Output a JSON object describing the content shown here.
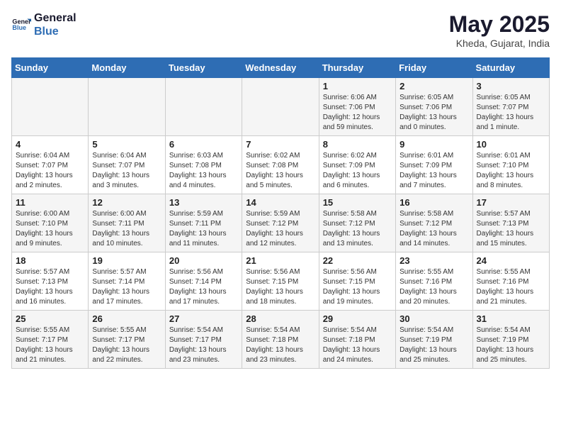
{
  "header": {
    "logo_line1": "General",
    "logo_line2": "Blue",
    "month": "May 2025",
    "location": "Kheda, Gujarat, India"
  },
  "weekdays": [
    "Sunday",
    "Monday",
    "Tuesday",
    "Wednesday",
    "Thursday",
    "Friday",
    "Saturday"
  ],
  "weeks": [
    [
      {
        "day": "",
        "info": ""
      },
      {
        "day": "",
        "info": ""
      },
      {
        "day": "",
        "info": ""
      },
      {
        "day": "",
        "info": ""
      },
      {
        "day": "1",
        "info": "Sunrise: 6:06 AM\nSunset: 7:06 PM\nDaylight: 12 hours\nand 59 minutes."
      },
      {
        "day": "2",
        "info": "Sunrise: 6:05 AM\nSunset: 7:06 PM\nDaylight: 13 hours\nand 0 minutes."
      },
      {
        "day": "3",
        "info": "Sunrise: 6:05 AM\nSunset: 7:07 PM\nDaylight: 13 hours\nand 1 minute."
      }
    ],
    [
      {
        "day": "4",
        "info": "Sunrise: 6:04 AM\nSunset: 7:07 PM\nDaylight: 13 hours\nand 2 minutes."
      },
      {
        "day": "5",
        "info": "Sunrise: 6:04 AM\nSunset: 7:07 PM\nDaylight: 13 hours\nand 3 minutes."
      },
      {
        "day": "6",
        "info": "Sunrise: 6:03 AM\nSunset: 7:08 PM\nDaylight: 13 hours\nand 4 minutes."
      },
      {
        "day": "7",
        "info": "Sunrise: 6:02 AM\nSunset: 7:08 PM\nDaylight: 13 hours\nand 5 minutes."
      },
      {
        "day": "8",
        "info": "Sunrise: 6:02 AM\nSunset: 7:09 PM\nDaylight: 13 hours\nand 6 minutes."
      },
      {
        "day": "9",
        "info": "Sunrise: 6:01 AM\nSunset: 7:09 PM\nDaylight: 13 hours\nand 7 minutes."
      },
      {
        "day": "10",
        "info": "Sunrise: 6:01 AM\nSunset: 7:10 PM\nDaylight: 13 hours\nand 8 minutes."
      }
    ],
    [
      {
        "day": "11",
        "info": "Sunrise: 6:00 AM\nSunset: 7:10 PM\nDaylight: 13 hours\nand 9 minutes."
      },
      {
        "day": "12",
        "info": "Sunrise: 6:00 AM\nSunset: 7:11 PM\nDaylight: 13 hours\nand 10 minutes."
      },
      {
        "day": "13",
        "info": "Sunrise: 5:59 AM\nSunset: 7:11 PM\nDaylight: 13 hours\nand 11 minutes."
      },
      {
        "day": "14",
        "info": "Sunrise: 5:59 AM\nSunset: 7:12 PM\nDaylight: 13 hours\nand 12 minutes."
      },
      {
        "day": "15",
        "info": "Sunrise: 5:58 AM\nSunset: 7:12 PM\nDaylight: 13 hours\nand 13 minutes."
      },
      {
        "day": "16",
        "info": "Sunrise: 5:58 AM\nSunset: 7:12 PM\nDaylight: 13 hours\nand 14 minutes."
      },
      {
        "day": "17",
        "info": "Sunrise: 5:57 AM\nSunset: 7:13 PM\nDaylight: 13 hours\nand 15 minutes."
      }
    ],
    [
      {
        "day": "18",
        "info": "Sunrise: 5:57 AM\nSunset: 7:13 PM\nDaylight: 13 hours\nand 16 minutes."
      },
      {
        "day": "19",
        "info": "Sunrise: 5:57 AM\nSunset: 7:14 PM\nDaylight: 13 hours\nand 17 minutes."
      },
      {
        "day": "20",
        "info": "Sunrise: 5:56 AM\nSunset: 7:14 PM\nDaylight: 13 hours\nand 17 minutes."
      },
      {
        "day": "21",
        "info": "Sunrise: 5:56 AM\nSunset: 7:15 PM\nDaylight: 13 hours\nand 18 minutes."
      },
      {
        "day": "22",
        "info": "Sunrise: 5:56 AM\nSunset: 7:15 PM\nDaylight: 13 hours\nand 19 minutes."
      },
      {
        "day": "23",
        "info": "Sunrise: 5:55 AM\nSunset: 7:16 PM\nDaylight: 13 hours\nand 20 minutes."
      },
      {
        "day": "24",
        "info": "Sunrise: 5:55 AM\nSunset: 7:16 PM\nDaylight: 13 hours\nand 21 minutes."
      }
    ],
    [
      {
        "day": "25",
        "info": "Sunrise: 5:55 AM\nSunset: 7:17 PM\nDaylight: 13 hours\nand 21 minutes."
      },
      {
        "day": "26",
        "info": "Sunrise: 5:55 AM\nSunset: 7:17 PM\nDaylight: 13 hours\nand 22 minutes."
      },
      {
        "day": "27",
        "info": "Sunrise: 5:54 AM\nSunset: 7:17 PM\nDaylight: 13 hours\nand 23 minutes."
      },
      {
        "day": "28",
        "info": "Sunrise: 5:54 AM\nSunset: 7:18 PM\nDaylight: 13 hours\nand 23 minutes."
      },
      {
        "day": "29",
        "info": "Sunrise: 5:54 AM\nSunset: 7:18 PM\nDaylight: 13 hours\nand 24 minutes."
      },
      {
        "day": "30",
        "info": "Sunrise: 5:54 AM\nSunset: 7:19 PM\nDaylight: 13 hours\nand 25 minutes."
      },
      {
        "day": "31",
        "info": "Sunrise: 5:54 AM\nSunset: 7:19 PM\nDaylight: 13 hours\nand 25 minutes."
      }
    ]
  ]
}
